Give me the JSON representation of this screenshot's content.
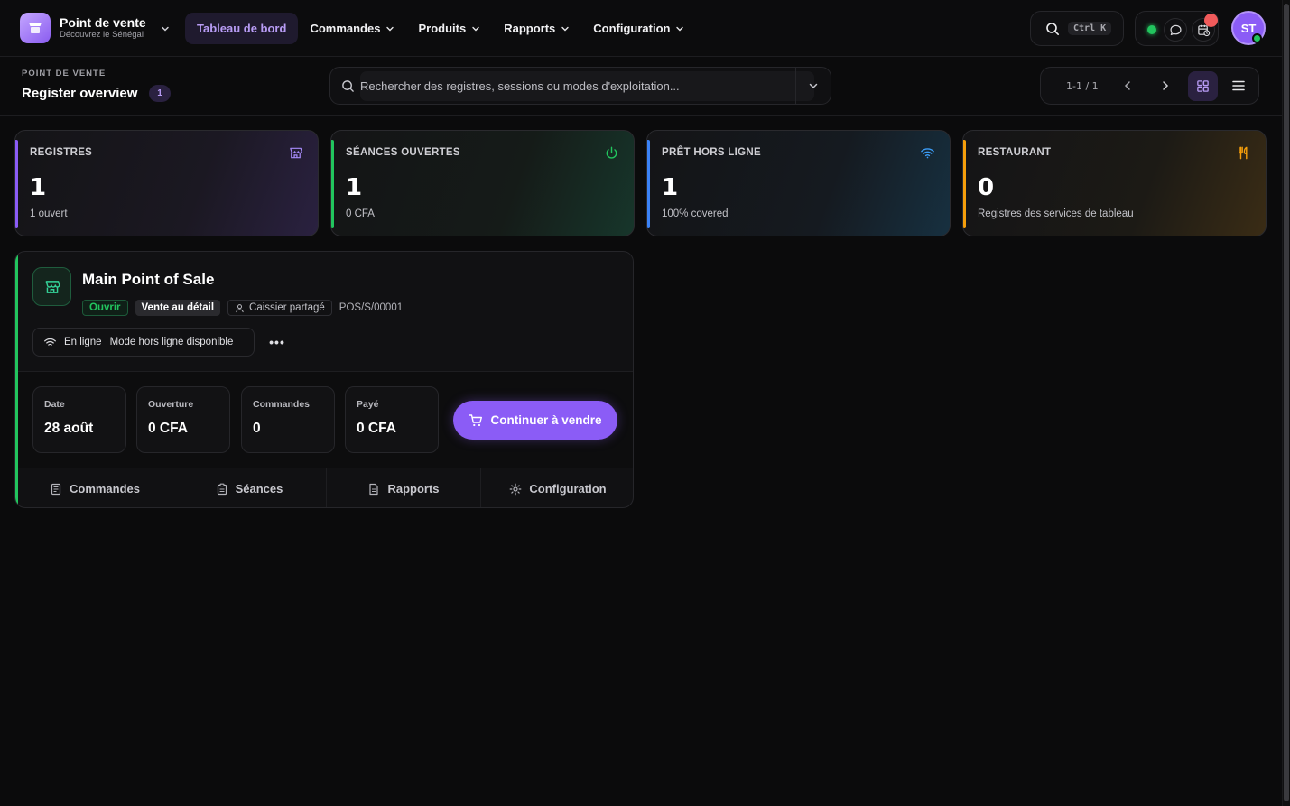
{
  "brand": {
    "title": "Point de vente",
    "subtitle": "Découvrez le Sénégal",
    "accent": "#8b5cf6"
  },
  "nav": {
    "items": [
      {
        "label": "Tableau de bord",
        "active": true
      },
      {
        "label": "Commandes",
        "dropdown": true
      },
      {
        "label": "Produits",
        "dropdown": true
      },
      {
        "label": "Rapports",
        "dropdown": true
      },
      {
        "label": "Configuration",
        "dropdown": true
      }
    ]
  },
  "header_tools": {
    "shortcut": "Ctrl K",
    "status_color": "#22c55e",
    "avatar_initials": "ST"
  },
  "subheader": {
    "breadcrumb": "POINT DE VENTE",
    "title": "Register overview",
    "count": "1",
    "search_placeholder": "Rechercher des registres, sessions ou modes d'exploitation...",
    "pager": "1-1 / 1"
  },
  "stats": [
    {
      "label": "REGISTRES",
      "value": "1",
      "sub": "1 ouvert",
      "icon": "store-icon",
      "color": "#8b5cf6"
    },
    {
      "label": "SÉANCES OUVERTES",
      "value": "1",
      "sub": "0 CFA",
      "icon": "power-icon",
      "color": "#22c55e"
    },
    {
      "label": "PRÊT HORS LIGNE",
      "value": "1",
      "sub": "100% covered",
      "icon": "wifi-icon",
      "color": "#3b82f6"
    },
    {
      "label": "RESTAURANT",
      "value": "0",
      "sub": "Registres des services de tableau",
      "icon": "utensils-icon",
      "color": "#f59e0b"
    }
  ],
  "register": {
    "name": "Main Point of Sale",
    "status": "Ouvrir",
    "type": "Vente au détail",
    "cashier": "Caissier partagé",
    "code": "POS/S/00001",
    "online_label": "En ligne",
    "offline_label": "Mode hors ligne disponible",
    "more": "•••",
    "metrics": [
      {
        "label": "Date",
        "value": "28 août"
      },
      {
        "label": "Ouverture",
        "value": "0 CFA"
      },
      {
        "label": "Commandes",
        "value": "0"
      },
      {
        "label": "Payé",
        "value": "0 CFA"
      }
    ],
    "cta": "Continuer à vendre",
    "actions": [
      {
        "label": "Commandes",
        "icon": "orders-icon"
      },
      {
        "label": "Séances",
        "icon": "clipboard-icon"
      },
      {
        "label": "Rapports",
        "icon": "report-icon"
      },
      {
        "label": "Configuration",
        "icon": "gear-icon"
      }
    ]
  }
}
